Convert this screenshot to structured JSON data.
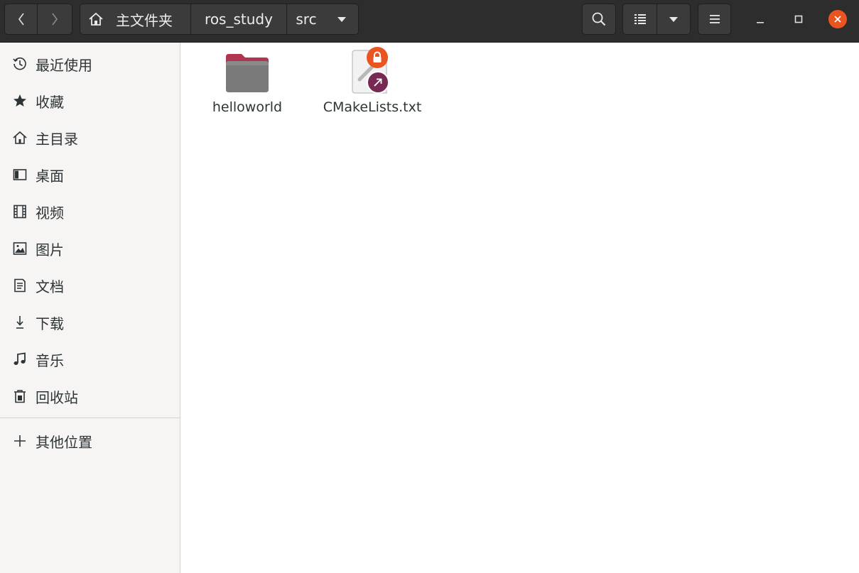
{
  "window": {
    "nav": {
      "back_icon": "chevron-left-icon",
      "forward_icon": "chevron-right-icon"
    },
    "path": {
      "home_icon": "home-icon",
      "segments": [
        "主文件夹",
        "ros_study",
        "src"
      ],
      "dropdown_icon": "triangle-down-icon"
    },
    "toolbar": {
      "search_icon": "search-icon",
      "view_icon": "list-view-icon",
      "view_dropdown_icon": "triangle-down-icon",
      "menu_icon": "hamburger-icon"
    },
    "controls": {
      "minimize_icon": "minimize-icon",
      "maximize_icon": "maximize-icon",
      "close_icon": "close-icon",
      "close_color": "#e95420"
    }
  },
  "sidebar": {
    "items": [
      {
        "label": "最近使用",
        "icon": "clock-icon"
      },
      {
        "label": "收藏",
        "icon": "star-icon"
      },
      {
        "label": "主目录",
        "icon": "home-icon"
      },
      {
        "label": "桌面",
        "icon": "desktop-icon"
      },
      {
        "label": "视频",
        "icon": "film-icon"
      },
      {
        "label": "图片",
        "icon": "picture-icon"
      },
      {
        "label": "文档",
        "icon": "document-icon"
      },
      {
        "label": "下载",
        "icon": "download-icon"
      },
      {
        "label": "音乐",
        "icon": "music-icon"
      },
      {
        "label": "回收站",
        "icon": "trash-icon"
      }
    ],
    "other": {
      "label": "其他位置",
      "icon": "plus-icon"
    }
  },
  "files": [
    {
      "name": "helloworld",
      "type": "folder"
    },
    {
      "name": "CMakeLists.txt",
      "type": "text-file-symlink-readonly",
      "badges": [
        "lock-icon",
        "symlink-arrow-icon"
      ]
    }
  ],
  "colors": {
    "header_bg": "#2d2d2d",
    "sidebar_bg": "#f6f5f4",
    "accent": "#e95420",
    "folder": "#7a7a7a",
    "folder_tab": "#b2354f"
  }
}
